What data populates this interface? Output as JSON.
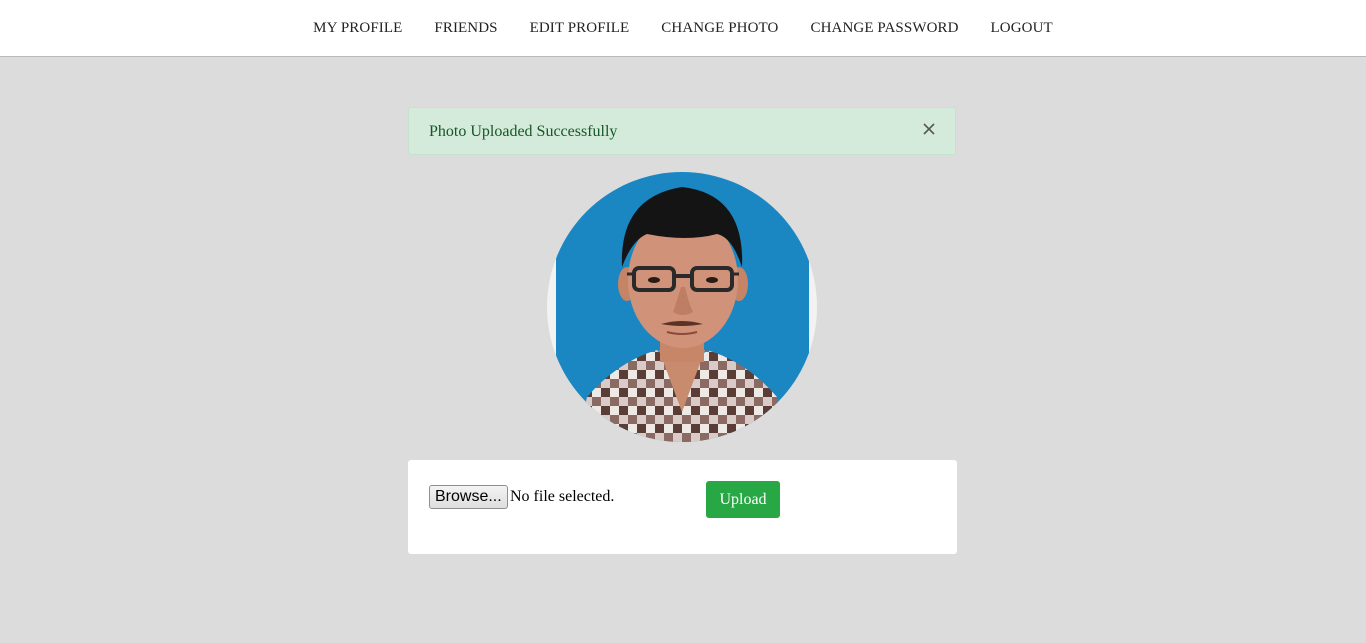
{
  "nav": {
    "items": [
      {
        "label": "MY PROFILE"
      },
      {
        "label": "FRIENDS"
      },
      {
        "label": "EDIT PROFILE"
      },
      {
        "label": "CHANGE PHOTO"
      },
      {
        "label": "CHANGE PASSWORD"
      },
      {
        "label": "LOGOUT"
      }
    ]
  },
  "alert": {
    "message": "Photo Uploaded Successfully",
    "close_icon": "close-icon",
    "bg_color": "#d4ebdb",
    "text_color": "#155724"
  },
  "profile_photo": {
    "icon": "profile-photo"
  },
  "upload_form": {
    "browse_label": "Browse...",
    "file_status": "No file selected.",
    "upload_label": "Upload",
    "upload_color": "#28a745"
  }
}
